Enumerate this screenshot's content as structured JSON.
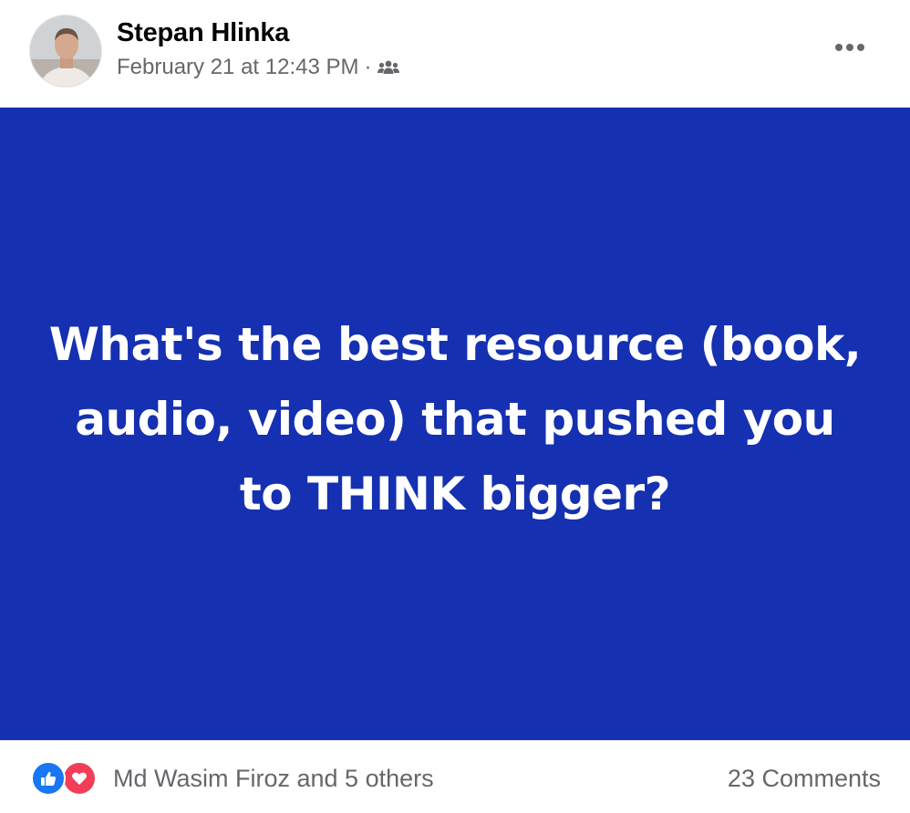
{
  "post": {
    "author": "Stepan Hlinka",
    "timestamp": "February 21 at 12:43 PM",
    "separator": "·",
    "audience_icon": "group-audience-icon",
    "more_icon": "more-options-icon",
    "text": "What's the best resource (book, audio, video) that pushed you to THINK bigger?",
    "background_color": "#1530b1",
    "text_color": "#ffffff"
  },
  "footer": {
    "reaction_icons": [
      "like-reaction-icon",
      "love-reaction-icon"
    ],
    "likers_text": "Md Wasim Firoz and 5 others",
    "comments_text": "23 Comments"
  },
  "colors": {
    "like_blue": "#1877f2",
    "love_red": "#f33e58",
    "secondary_text": "#65676b"
  }
}
